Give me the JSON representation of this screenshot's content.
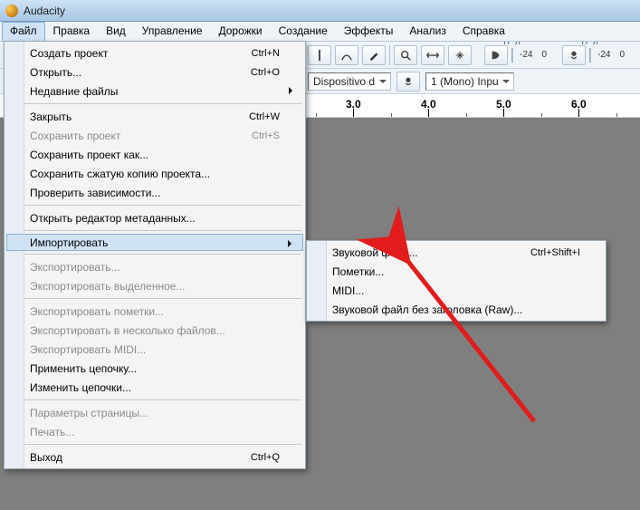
{
  "window": {
    "title": "Audacity"
  },
  "menubar": {
    "items": [
      "Файл",
      "Правка",
      "Вид",
      "Управление",
      "Дорожки",
      "Создание",
      "Эффекты",
      "Анализ",
      "Справка"
    ]
  },
  "file_menu": {
    "new": {
      "label": "Создать проект",
      "shortcut": "Ctrl+N"
    },
    "open": {
      "label": "Открыть...",
      "shortcut": "Ctrl+O"
    },
    "recent": {
      "label": "Недавние файлы"
    },
    "close": {
      "label": "Закрыть",
      "shortcut": "Ctrl+W"
    },
    "save": {
      "label": "Сохранить проект",
      "shortcut": "Ctrl+S"
    },
    "saveas": {
      "label": "Сохранить проект как..."
    },
    "savecomp": {
      "label": "Сохранить сжатую копию проекта..."
    },
    "checkdeps": {
      "label": "Проверить зависимости..."
    },
    "metaeditor": {
      "label": "Открыть редактор метаданных..."
    },
    "import": {
      "label": "Импортировать"
    },
    "export": {
      "label": "Экспортировать..."
    },
    "exportsel": {
      "label": "Экспортировать выделенное..."
    },
    "exportlabels": {
      "label": "Экспортировать пометки..."
    },
    "exportmulti": {
      "label": "Экспортировать в несколько файлов..."
    },
    "exportmidi": {
      "label": "Экспортировать MIDI..."
    },
    "applychain": {
      "label": "Применить цепочку..."
    },
    "editchains": {
      "label": "Изменить цепочки..."
    },
    "pagesetup": {
      "label": "Параметры страницы..."
    },
    "print": {
      "label": "Печать..."
    },
    "exit": {
      "label": "Выход",
      "shortcut": "Ctrl+Q"
    }
  },
  "import_menu": {
    "audio": {
      "label": "Звуковой файл...",
      "shortcut": "Ctrl+Shift+I"
    },
    "labels": {
      "label": "Пометки..."
    },
    "midi": {
      "label": "MIDI..."
    },
    "raw": {
      "label": "Звуковой файл без заголовка (Raw)..."
    }
  },
  "device_bar": {
    "host": "Dispositivo d",
    "rec_device": "1 (Mono)  Inpu"
  },
  "meters": {
    "left": "Л",
    "right": "П",
    "db1": "-24",
    "db2": "0",
    "db3": "-24",
    "db4": "0"
  },
  "ruler": {
    "t0": "3.0",
    "t1": "4.0",
    "t2": "5.0",
    "t3": "6.0"
  }
}
